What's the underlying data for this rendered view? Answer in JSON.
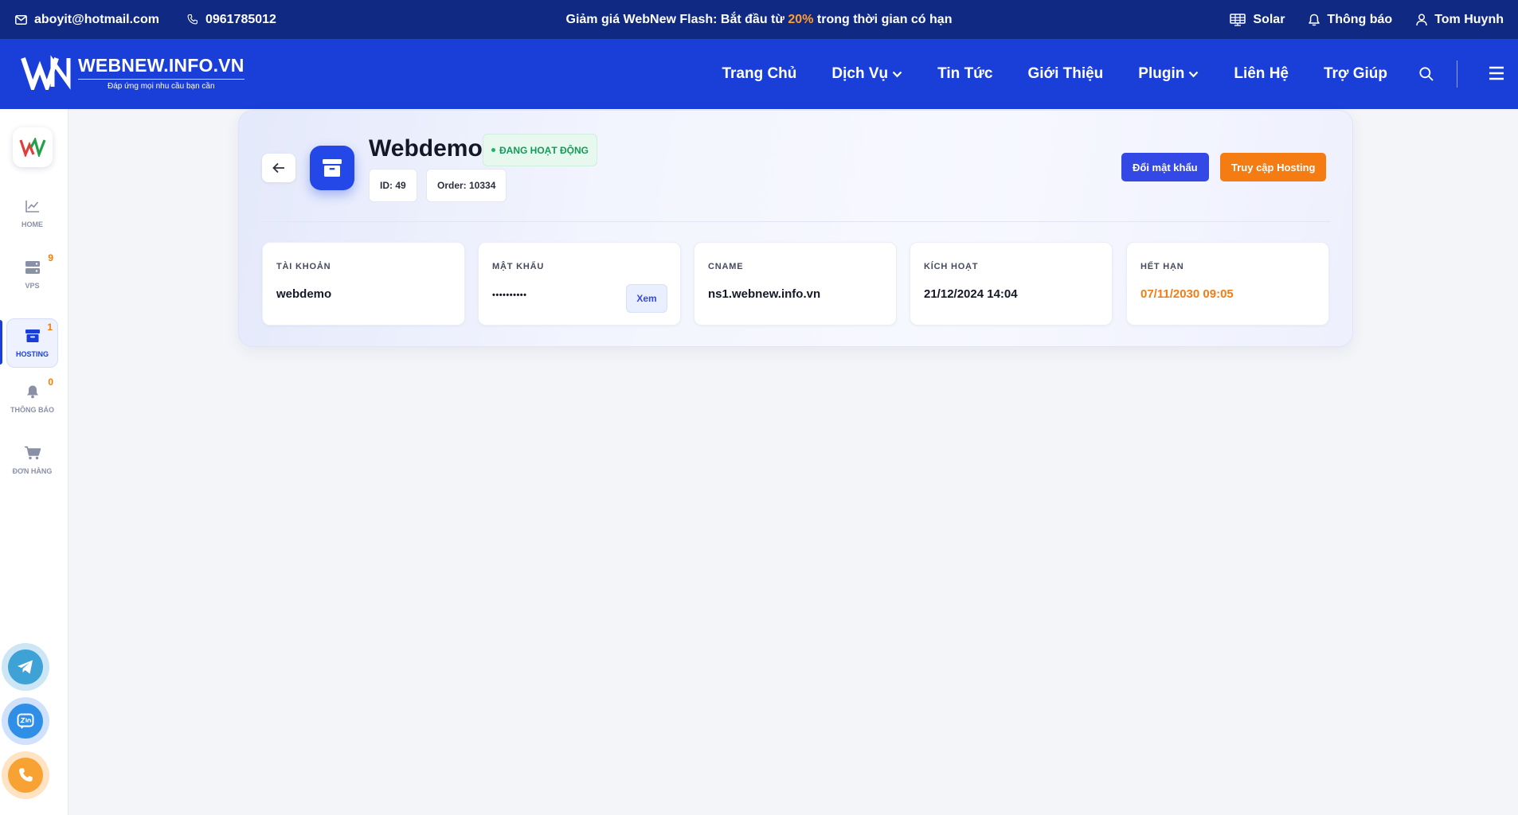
{
  "topbar": {
    "email": "aboyit@hotmail.com",
    "phone": "0961785012",
    "promo_pre": "Giảm giá WebNew Flash: Bắt đầu từ ",
    "promo_pct": "20%",
    "promo_post": " trong thời gian có hạn",
    "theme": "Solar",
    "notifications": "Thông báo",
    "user": "Tom Huynh"
  },
  "brand": {
    "name": "WEBNEW.INFO.VN",
    "tagline": "Đáp ứng mọi nhu cầu bạn cần"
  },
  "nav": {
    "home": "Trang Chủ",
    "services": "Dịch Vụ",
    "news": "Tin Tức",
    "about": "Giới Thiệu",
    "plugin": "Plugin",
    "contact": "Liên Hệ",
    "help": "Trợ Giúp"
  },
  "sidebar": {
    "items": [
      {
        "label": "HOME",
        "badge": ""
      },
      {
        "label": "VPS",
        "badge": "9"
      },
      {
        "label": "HOSTING",
        "badge": "1"
      },
      {
        "label": "THÔNG BÁO",
        "badge": "0"
      },
      {
        "label": "ĐƠN HÀNG",
        "badge": ""
      }
    ]
  },
  "service": {
    "title": "Webdemo",
    "status": "ĐANG HOẠT ĐỘNG",
    "id": "ID: 49",
    "order": "Order: 10334",
    "change_password": "Đổi mật khẩu",
    "access_hosting": "Truy cập Hosting"
  },
  "details": {
    "account_label": "TÀI KHOẢN",
    "account_value": "webdemo",
    "password_label": "MẬT KHẨU",
    "password_value": "••••••••••",
    "password_view": "Xem",
    "cname_label": "CNAME",
    "cname_value": "ns1.webnew.info.vn",
    "activated_label": "KÍCH HOẠT",
    "activated_value": "21/12/2024 14:04",
    "expires_label": "HẾT HẠN",
    "expires_value": "07/11/2030 09:05"
  },
  "colors": {
    "topbar": "#102a83",
    "navbar": "#1a3fd9",
    "accent_orange": "#f57c12",
    "primary_button": "#3448e6",
    "status_green": "#149a58"
  },
  "icons": {
    "email": "mail-icon",
    "phone": "phone-icon",
    "theme": "palette-icon",
    "notifications": "bell-icon",
    "user": "user-icon",
    "search": "search-icon",
    "menu": "hamburger-icon",
    "service": "archive-box-icon",
    "back": "arrow-left-icon"
  }
}
